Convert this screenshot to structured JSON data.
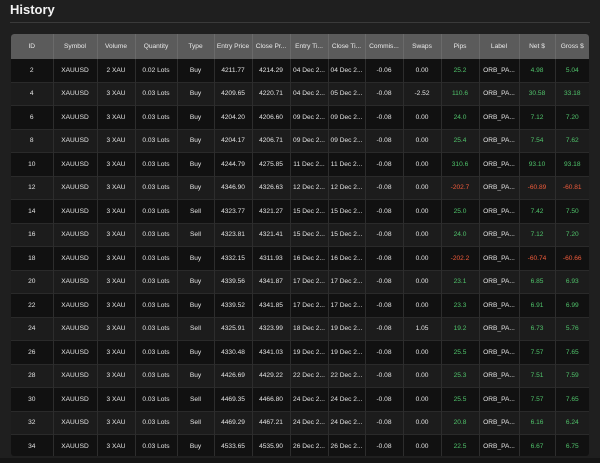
{
  "page": {
    "title": "History"
  },
  "colors": {
    "positive": "#4fc26a",
    "negative": "#ef5b3b",
    "header_bg": "#5b5b5b"
  },
  "table": {
    "columns": [
      "ID",
      "Symbol",
      "Volume",
      "Quantity",
      "Type",
      "Entry Price",
      "Close Pr...",
      "Entry Ti...",
      "Close Ti...",
      "Commis...",
      "Swaps",
      "Pips",
      "Label",
      "Net $",
      "Gross $"
    ],
    "rows": [
      [
        "2",
        "XAUUSD",
        "2 XAU",
        "0.02 Lots",
        "Buy",
        "4211.77",
        "4214.29",
        "04 Dec 2...",
        "04 Dec 2...",
        "-0.06",
        "0.00",
        "25.2",
        "ORB_PA...",
        "4.98",
        "5.04"
      ],
      [
        "4",
        "XAUUSD",
        "3 XAU",
        "0.03 Lots",
        "Buy",
        "4209.65",
        "4220.71",
        "04 Dec 2...",
        "05 Dec 2...",
        "-0.08",
        "-2.52",
        "110.6",
        "ORB_PA...",
        "30.58",
        "33.18"
      ],
      [
        "6",
        "XAUUSD",
        "3 XAU",
        "0.03 Lots",
        "Buy",
        "4204.20",
        "4206.60",
        "09 Dec 2...",
        "09 Dec 2...",
        "-0.08",
        "0.00",
        "24.0",
        "ORB_PA...",
        "7.12",
        "7.20"
      ],
      [
        "8",
        "XAUUSD",
        "3 XAU",
        "0.03 Lots",
        "Buy",
        "4204.17",
        "4206.71",
        "09 Dec 2...",
        "09 Dec 2...",
        "-0.08",
        "0.00",
        "25.4",
        "ORB_PA...",
        "7.54",
        "7.62"
      ],
      [
        "10",
        "XAUUSD",
        "3 XAU",
        "0.03 Lots",
        "Buy",
        "4244.79",
        "4275.85",
        "11 Dec 2...",
        "11 Dec 2...",
        "-0.08",
        "0.00",
        "310.6",
        "ORB_PA...",
        "93.10",
        "93.18"
      ],
      [
        "12",
        "XAUUSD",
        "3 XAU",
        "0.03 Lots",
        "Buy",
        "4346.90",
        "4326.63",
        "12 Dec 2...",
        "12 Dec 2...",
        "-0.08",
        "0.00",
        "-202.7",
        "ORB_PA...",
        "-60.89",
        "-60.81"
      ],
      [
        "14",
        "XAUUSD",
        "3 XAU",
        "0.03 Lots",
        "Sell",
        "4323.77",
        "4321.27",
        "15 Dec 2...",
        "15 Dec 2...",
        "-0.08",
        "0.00",
        "25.0",
        "ORB_PA...",
        "7.42",
        "7.50"
      ],
      [
        "16",
        "XAUUSD",
        "3 XAU",
        "0.03 Lots",
        "Sell",
        "4323.81",
        "4321.41",
        "15 Dec 2...",
        "15 Dec 2...",
        "-0.08",
        "0.00",
        "24.0",
        "ORB_PA...",
        "7.12",
        "7.20"
      ],
      [
        "18",
        "XAUUSD",
        "3 XAU",
        "0.03 Lots",
        "Buy",
        "4332.15",
        "4311.93",
        "16 Dec 2...",
        "16 Dec 2...",
        "-0.08",
        "0.00",
        "-202.2",
        "ORB_PA...",
        "-60.74",
        "-60.66"
      ],
      [
        "20",
        "XAUUSD",
        "3 XAU",
        "0.03 Lots",
        "Buy",
        "4339.56",
        "4341.87",
        "17 Dec 2...",
        "17 Dec 2...",
        "-0.08",
        "0.00",
        "23.1",
        "ORB_PA...",
        "6.85",
        "6.93"
      ],
      [
        "22",
        "XAUUSD",
        "3 XAU",
        "0.03 Lots",
        "Buy",
        "4339.52",
        "4341.85",
        "17 Dec 2...",
        "17 Dec 2...",
        "-0.08",
        "0.00",
        "23.3",
        "ORB_PA...",
        "6.91",
        "6.99"
      ],
      [
        "24",
        "XAUUSD",
        "3 XAU",
        "0.03 Lots",
        "Sell",
        "4325.91",
        "4323.99",
        "18 Dec 2...",
        "19 Dec 2...",
        "-0.08",
        "1.05",
        "19.2",
        "ORB_PA...",
        "6.73",
        "5.76"
      ],
      [
        "26",
        "XAUUSD",
        "3 XAU",
        "0.03 Lots",
        "Buy",
        "4330.48",
        "4341.03",
        "19 Dec 2...",
        "19 Dec 2...",
        "-0.08",
        "0.00",
        "25.5",
        "ORB_PA...",
        "7.57",
        "7.65"
      ],
      [
        "28",
        "XAUUSD",
        "3 XAU",
        "0.03 Lots",
        "Buy",
        "4426.69",
        "4429.22",
        "22 Dec 2...",
        "22 Dec 2...",
        "-0.08",
        "0.00",
        "25.3",
        "ORB_PA...",
        "7.51",
        "7.59"
      ],
      [
        "30",
        "XAUUSD",
        "3 XAU",
        "0.03 Lots",
        "Sell",
        "4469.35",
        "4466.80",
        "24 Dec 2...",
        "24 Dec 2...",
        "-0.08",
        "0.00",
        "25.5",
        "ORB_PA...",
        "7.57",
        "7.65"
      ],
      [
        "32",
        "XAUUSD",
        "3 XAU",
        "0.03 Lots",
        "Sell",
        "4469.29",
        "4467.21",
        "24 Dec 2...",
        "24 Dec 2...",
        "-0.08",
        "0.00",
        "20.8",
        "ORB_PA...",
        "6.16",
        "6.24"
      ],
      [
        "34",
        "XAUUSD",
        "3 XAU",
        "0.03 Lots",
        "Buy",
        "4533.65",
        "4535.90",
        "26 Dec 2...",
        "26 Dec 2...",
        "-0.08",
        "0.00",
        "22.5",
        "ORB_PA...",
        "6.67",
        "6.75"
      ]
    ]
  }
}
